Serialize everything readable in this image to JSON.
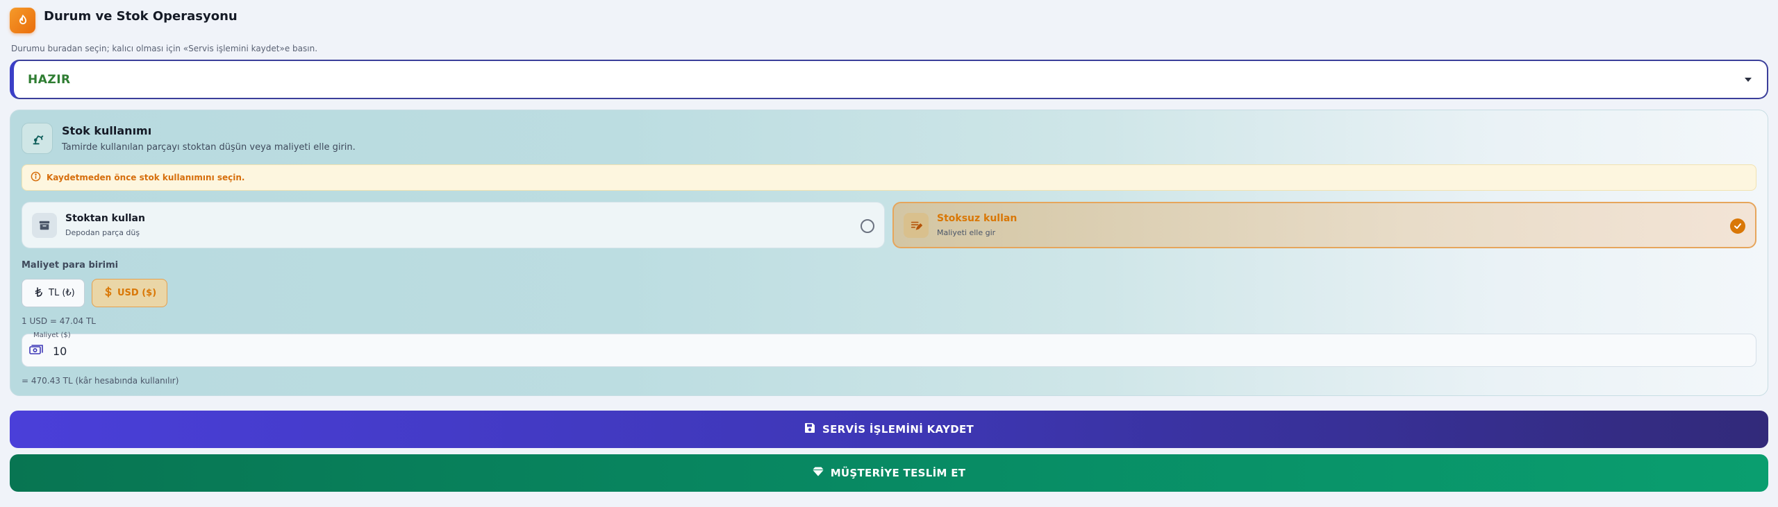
{
  "header": {
    "title": "Durum ve Stok Operasyonu",
    "hint": "Durumu buradan seçin; kalıcı olması için «Servis işlemini kaydet»e basın."
  },
  "status": {
    "selected": "HAZIR",
    "selected_color": "#2f7d32"
  },
  "stock": {
    "title": "Stok kullanımı",
    "subtitle": "Tamirde kullanılan parçayı stoktan düşün veya maliyeti elle girin.",
    "warning": "Kaydetmeden önce stok kullanımını seçin.",
    "options": [
      {
        "title": "Stoktan kullan",
        "subtitle": "Depodan parça düş",
        "selected": false,
        "icon": "archive-box-icon"
      },
      {
        "title": "Stoksuz kullan",
        "subtitle": "Maliyeti elle gir",
        "selected": true,
        "icon": "edit-note-icon"
      }
    ]
  },
  "currency": {
    "label": "Maliyet para birimi",
    "options": [
      {
        "label": "TL (₺)",
        "icon": "lira-icon",
        "selected": false
      },
      {
        "label": "USD ($)",
        "icon": "dollar-icon",
        "selected": true
      }
    ],
    "rate": "1 USD = 47.04 TL"
  },
  "cost": {
    "label": "Maliyet ($)",
    "value": "10",
    "converted": "= 470.43 TL (kâr hesabında kullanılır)"
  },
  "actions": {
    "save": "SERVİS İŞLEMİNİ KAYDET",
    "deliver": "MÜŞTERİYE TESLİM ET"
  },
  "colors": {
    "accent_orange": "#d97706",
    "primary_indigo": "#3e37b6",
    "success_green": "#088a63"
  }
}
